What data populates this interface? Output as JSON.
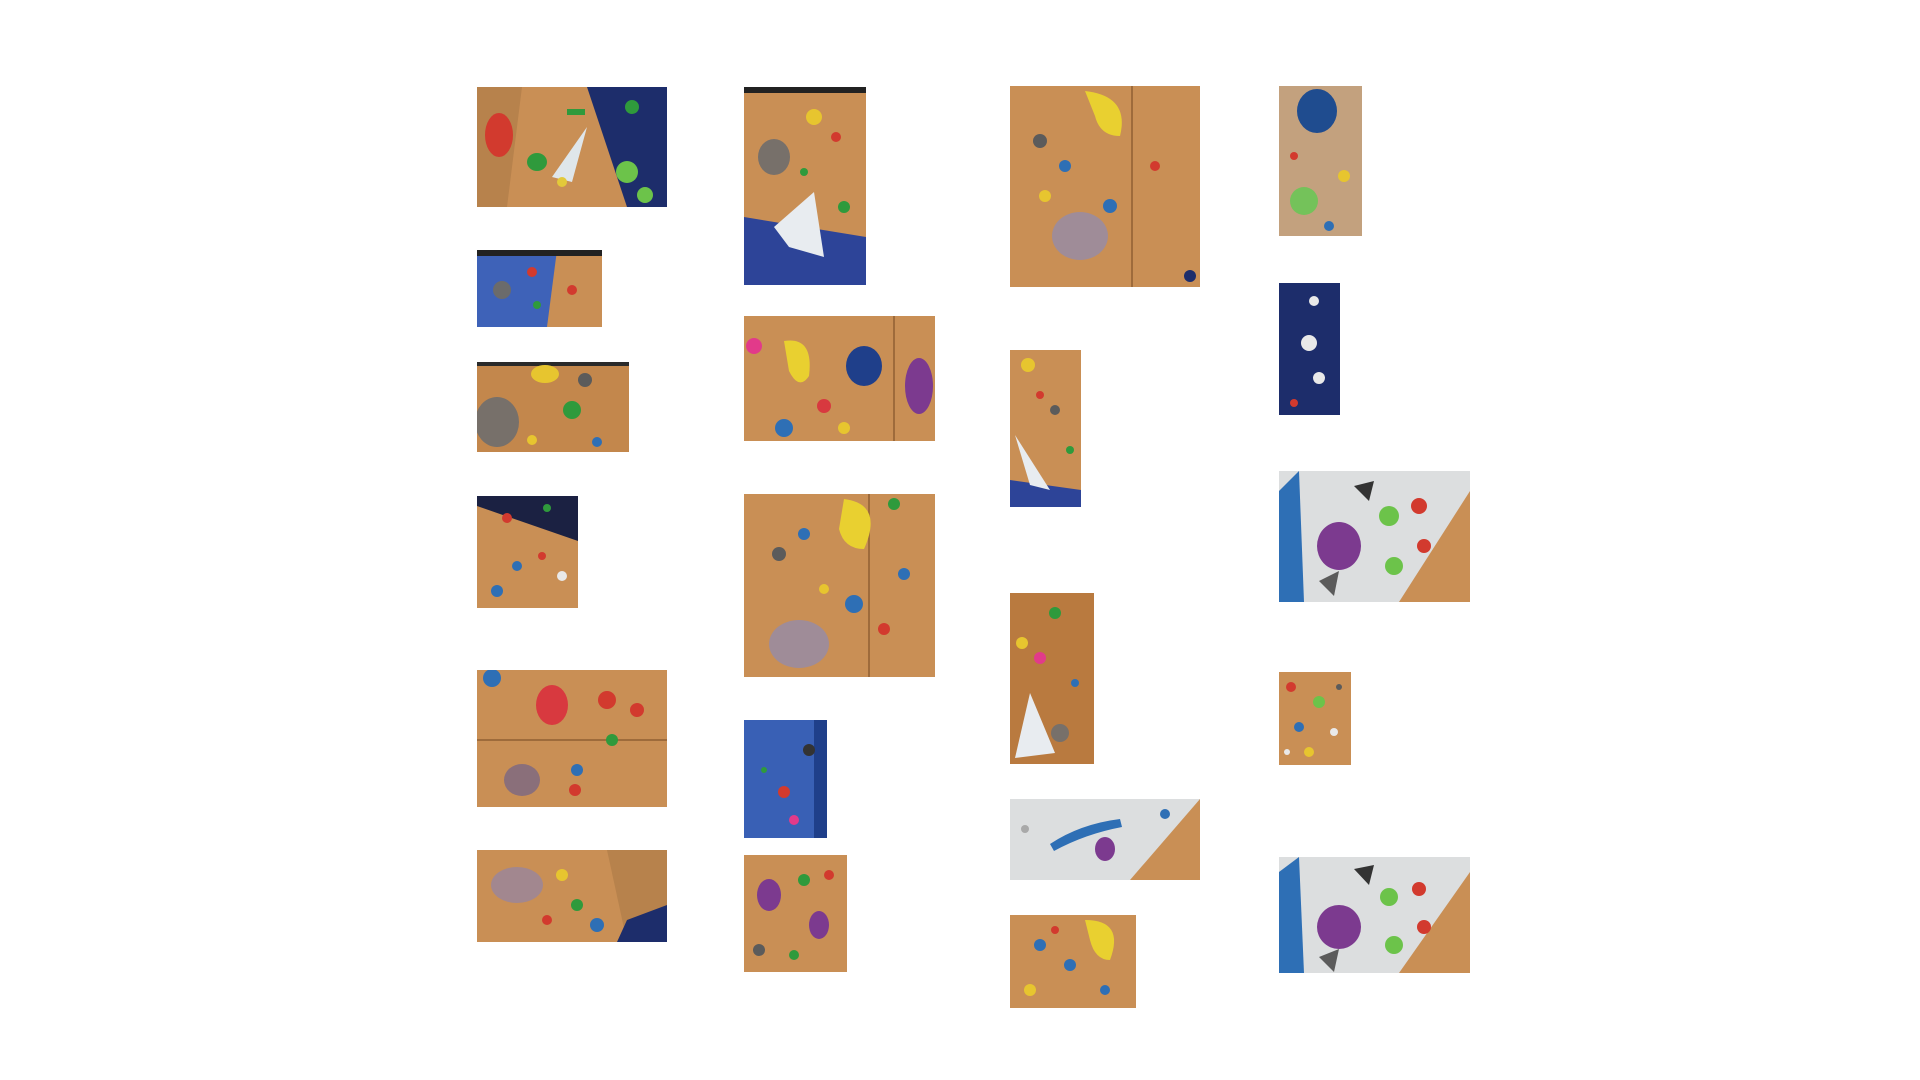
{
  "gallery": {
    "photos": [
      {
        "id": "p1",
        "scene": "wood-wall-with-navy-panel-and-red-green-holds"
      },
      {
        "id": "p2",
        "scene": "navy-wall-with-grey-hold-and-wood-corner"
      },
      {
        "id": "p3",
        "scene": "wood-wall-with-grey-volume-and-yellow-holds"
      },
      {
        "id": "p4",
        "scene": "dark-navy-and-wood-wall-with-small-holds"
      },
      {
        "id": "p5",
        "scene": "wood-wall-with-red-pink-holds-and-purple-volume"
      },
      {
        "id": "p6",
        "scene": "wood-wall-with-pink-volume-and-navy-corner"
      },
      {
        "id": "p7",
        "scene": "wood-corner-with-grey-hold-and-white-triangle-volume"
      },
      {
        "id": "p8",
        "scene": "wood-wall-with-yellow-blue-purple-holds"
      },
      {
        "id": "p9",
        "scene": "wood-wall-with-yellow-hold-and-pink-volume"
      },
      {
        "id": "p10",
        "scene": "navy-wall-with-small-holds"
      },
      {
        "id": "p11",
        "scene": "wood-wall-with-purple-green-holds"
      },
      {
        "id": "p12",
        "scene": "wood-wall-with-yellow-hold-and-pink-volume"
      },
      {
        "id": "p13",
        "scene": "narrow-wood-wall-with-white-volume"
      },
      {
        "id": "p14",
        "scene": "narrow-wood-wall-with-white-volume-and-grey-hold"
      },
      {
        "id": "p15",
        "scene": "white-wall-with-blue-rail-and-purple-hold"
      },
      {
        "id": "p16",
        "scene": "wood-wall-with-yellow-and-blue-holds"
      },
      {
        "id": "p17",
        "scene": "wood-wall-with-blue-and-green-holds"
      },
      {
        "id": "p18",
        "scene": "navy-wall-with-white-holds"
      },
      {
        "id": "p19",
        "scene": "white-and-wood-wall-with-purple-and-green-holds"
      },
      {
        "id": "p20",
        "scene": "wood-wall-with-scattered-small-holds"
      },
      {
        "id": "p21",
        "scene": "white-and-wood-wall-with-purple-and-green-holds"
      }
    ]
  }
}
